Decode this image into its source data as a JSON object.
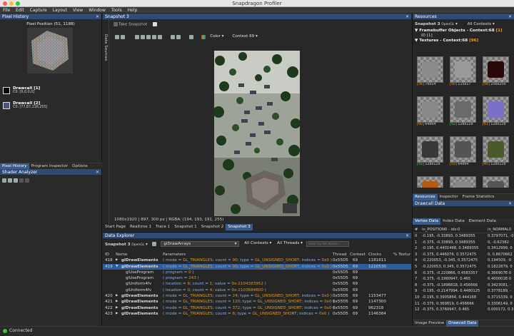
{
  "app": {
    "title": "Snapdragon Profiler"
  },
  "menu": [
    "File",
    "Edit",
    "Capture",
    "Layout",
    "View",
    "Window",
    "Tools",
    "Help"
  ],
  "pixel_history": {
    "title": "Pixel History",
    "position": "Pixel Position (51, 1188)",
    "drawcalls": [
      {
        "label": "Drawcall [1]",
        "value": "C0: [0,0,0,0]"
      },
      {
        "label": "Drawcall [2]",
        "value": "C0: [77,87,116,255]"
      }
    ],
    "tabs": [
      "Pixel History",
      "Program Inspector",
      "Options"
    ]
  },
  "shader_analyzer": {
    "title": "Shader Analyzer"
  },
  "status": {
    "text": "Connected"
  },
  "snapshot": {
    "title": "Snapshot 3",
    "take_snapshot": "Take Snapshot",
    "side_label": "Data Sources",
    "color_label": "Color",
    "context": "Context 69",
    "info": "1080x1920 | 897, 300 px | RGBA: (194, 193, 191, 255)",
    "tabs": [
      "Start Page",
      "Realtime 1",
      "Trace 1",
      "Snapshot 1",
      "Snapshot 2",
      "Snapshot 3"
    ]
  },
  "data_explorer": {
    "title": "Data Explorer",
    "snapshot": "Snapshot 3",
    "api": "OpenGL",
    "search": "glDrawArrays",
    "contexts": "All Contexts",
    "threads": "All Threads",
    "filter_placeholder": "Filter by API Name...",
    "columns": [
      "ID",
      "Name",
      "Parameters",
      "Thread",
      "Context",
      "Clocks",
      "% Textur"
    ],
    "rows": [
      {
        "id": "418",
        "name": "glDrawElements",
        "expand": "▶",
        "params": [
          [
            "( mode = ",
            ""
          ],
          [
            "GL_TRIANGLES",
            "h"
          ],
          [
            "; count = ",
            ""
          ],
          [
            "90",
            "h"
          ],
          [
            "; type = ",
            ""
          ],
          [
            "GL_UNSIGNED_SHORT",
            "h"
          ],
          [
            "; indices = ",
            ""
          ],
          [
            "0x0",
            "h"
          ],
          [
            " )",
            ""
          ]
        ],
        "thread": "0x55D5",
        "context": "69",
        "clocks": "1181611",
        "sub": false
      },
      {
        "id": "419",
        "name": "glDrawElements",
        "expand": "▼",
        "params": [
          [
            "( mode = ",
            ""
          ],
          [
            "GL_TRIANGLES",
            "h"
          ],
          [
            "; count = ",
            ""
          ],
          [
            "90",
            "h"
          ],
          [
            "; type = ",
            ""
          ],
          [
            "GL_UNSIGNED_SHORT",
            "h"
          ],
          [
            "; indices = ",
            ""
          ],
          [
            "0x0",
            "h"
          ],
          [
            " )",
            ""
          ]
        ],
        "thread": "0x55D5",
        "context": "69",
        "clocks": "1220530",
        "sub": false
      },
      {
        "id": "",
        "name": "glUseProgram",
        "expand": "",
        "params": [
          [
            "( program = ",
            ""
          ],
          [
            "0",
            "h"
          ],
          [
            " )",
            ""
          ]
        ],
        "thread": "0x55D5",
        "context": "69",
        "clocks": "",
        "sub": true
      },
      {
        "id": "",
        "name": "glUseProgram",
        "expand": "",
        "params": [
          [
            "( program = ",
            ""
          ],
          [
            "243",
            "h"
          ],
          [
            " )",
            ""
          ]
        ],
        "thread": "0x55D5",
        "context": "69",
        "clocks": "",
        "sub": true
      },
      {
        "id": "",
        "name": "glUniform4fv",
        "expand": "",
        "params": [
          [
            "( location = ",
            ""
          ],
          [
            "9",
            "h"
          ],
          [
            "; count = ",
            ""
          ],
          [
            "1",
            "h"
          ],
          [
            "; value = ",
            ""
          ],
          [
            "0x-2104383952",
            "h"
          ],
          [
            " )",
            ""
          ]
        ],
        "thread": "0x55D5",
        "context": "69",
        "clocks": "",
        "sub": true
      },
      {
        "id": "",
        "name": "glUniform4fv",
        "expand": "",
        "params": [
          [
            "( location = ",
            ""
          ],
          [
            "0",
            "h"
          ],
          [
            "; count = ",
            ""
          ],
          [
            "4",
            "h"
          ],
          [
            "; value = ",
            ""
          ],
          [
            "0x-2103684800",
            "h"
          ],
          [
            " )",
            ""
          ]
        ],
        "thread": "0x55D5",
        "context": "69",
        "clocks": "",
        "sub": true
      },
      {
        "id": "420",
        "name": "glDrawElements",
        "expand": "▶",
        "params": [
          [
            "( mode = ",
            ""
          ],
          [
            "GL_TRIANGLES",
            "h"
          ],
          [
            "; count = ",
            ""
          ],
          [
            "24",
            "h"
          ],
          [
            "; type = ",
            ""
          ],
          [
            "GL_UNSIGNED_SHORT",
            "h"
          ],
          [
            "; indices = ",
            ""
          ],
          [
            "0x0",
            "h"
          ],
          [
            " )",
            ""
          ]
        ],
        "thread": "0x55D5",
        "context": "69",
        "clocks": "1153477",
        "sub": false
      },
      {
        "id": "421",
        "name": "glDrawElements",
        "expand": "▶",
        "params": [
          [
            "( mode = ",
            ""
          ],
          [
            "GL_TRIANGLES",
            "h"
          ],
          [
            "; count = ",
            ""
          ],
          [
            "120",
            "h"
          ],
          [
            "; type = ",
            ""
          ],
          [
            "GL_UNSIGNED_SHORT",
            "h"
          ],
          [
            "; indices = ",
            ""
          ],
          [
            "0x0",
            "h"
          ],
          [
            " )",
            ""
          ]
        ],
        "thread": "0x55D5",
        "context": "69",
        "clocks": "1147300",
        "sub": false
      },
      {
        "id": "422",
        "name": "glDrawElements",
        "expand": "▶",
        "params": [
          [
            "( mode = ",
            ""
          ],
          [
            "GL_TRIANGLES",
            "h"
          ],
          [
            "; count = ",
            ""
          ],
          [
            "372",
            "h"
          ],
          [
            "; type = ",
            ""
          ],
          [
            "GL_UNSIGNED_SHORT",
            "h"
          ],
          [
            "; indices = ",
            ""
          ],
          [
            "0x0",
            "h"
          ],
          [
            " )",
            ""
          ]
        ],
        "thread": "0x55D5",
        "context": "69",
        "clocks": "962318",
        "sub": false
      },
      {
        "id": "423",
        "name": "glDrawElements",
        "expand": "▶",
        "params": [
          [
            "( mode = ",
            ""
          ],
          [
            "GL_TRIANGLES",
            "h"
          ],
          [
            "; count = ",
            ""
          ],
          [
            "6",
            "h"
          ],
          [
            "; type = ",
            ""
          ],
          [
            "GL_UNSIGNED_SHORT",
            "h"
          ],
          [
            "; indices = ",
            ""
          ],
          [
            "0x0",
            "h"
          ],
          [
            " )",
            ""
          ]
        ],
        "thread": "0x55D5",
        "context": "69",
        "clocks": "1146384",
        "sub": false
      }
    ]
  },
  "resources": {
    "title": "Resources",
    "snapshot": "Snapshot 3",
    "api": "OpenGL",
    "contexts": "All Contexts",
    "fbo_header": "Framebuffer Objects - Context:68",
    "fbo_count": "[1]",
    "fbo_id": "ID [1]",
    "tex_header": "Textures - Context:68",
    "tex_count": "[96]",
    "textures": [
      {
        "id": "[56]",
        "size": "76x14",
        "c": "#8a8a8a",
        "g": false
      },
      {
        "id": "[50]",
        "size": "115x17",
        "c": "#9a9a9a",
        "g": false
      },
      {
        "id": "[58]",
        "size": "256x256",
        "c": "#2a0808",
        "g": false
      },
      {
        "id": "[60]",
        "size": "64x64",
        "c": "#888",
        "g": false
      },
      {
        "id": "[52]",
        "size": "128x128",
        "c": "#6a6a6a",
        "g": true
      },
      {
        "id": "[61]",
        "size": "128x128",
        "c": "#7a70c8",
        "g": false
      },
      {
        "id": "[55]",
        "size": "128x128",
        "c": "#383838",
        "g": true
      },
      {
        "id": "[53]",
        "size": "64x64",
        "c": "#555",
        "g": false
      },
      {
        "id": "[45]",
        "size": "128x128",
        "c": "#4a5a2a",
        "g": false
      },
      {
        "id": "",
        "size": "",
        "c": "#b85a10",
        "g": false
      },
      {
        "id": "",
        "size": "",
        "c": "#888",
        "g": false
      },
      {
        "id": "",
        "size": "",
        "c": "#555",
        "g": false
      }
    ],
    "tabs": [
      "Resources",
      "Inspector",
      "Frame Statistics"
    ]
  },
  "drawcall_data": {
    "title": "Drawcall Data",
    "tabs": [
      "Vertex Data",
      "Index Data",
      "Element Data"
    ],
    "columns": [
      "#",
      "in_POSITION0 - idx:0",
      "in_NORMAL0"
    ],
    "rows": [
      [
        "0",
        "-0.195, -0.33893, 0.3489355",
        "0.3797071, -0"
      ],
      [
        "1",
        "-0.375, -0.33893, 0.3489355",
        "0, -0.62382"
      ],
      [
        "2",
        "-0.195, 0.4401468, 0.3489355",
        "0.3412999, 0"
      ],
      [
        "3",
        "-0.375, 0.446076, 0.3572475",
        "0, 0.8670662"
      ],
      [
        "4",
        "-0.220053, -0.345, 0.3572475",
        "0.194509, -0"
      ],
      [
        "5",
        "-0.220053, 0.345, 0.3572475",
        "0.1822879, 0"
      ],
      [
        "6",
        "-0.375, -0.220866, 0.4583357",
        "6.366907E-0"
      ],
      [
        "7",
        "-0.375, -0.1960947, 0.465",
        "6.400001E-0"
      ],
      [
        "8",
        "-0.375, -0.1896818, 0.456666",
        "0.3423081, -"
      ],
      [
        "9",
        "-0.195, -0.2147994, 0.4480125",
        "0.3778189, -"
      ],
      [
        "10",
        "-0.195, 0.3905864, 0.444168",
        "0.3715339, 0"
      ],
      [
        "11",
        "-0.375, 0.369819, 0.456666",
        "0.3306149, 0"
      ],
      [
        "12",
        "-0.375, 0.3760947, 0.465",
        "0.000172, 0.3"
      ]
    ],
    "tabs_bottom": [
      "Image Preview",
      "Drawcall Data"
    ]
  }
}
